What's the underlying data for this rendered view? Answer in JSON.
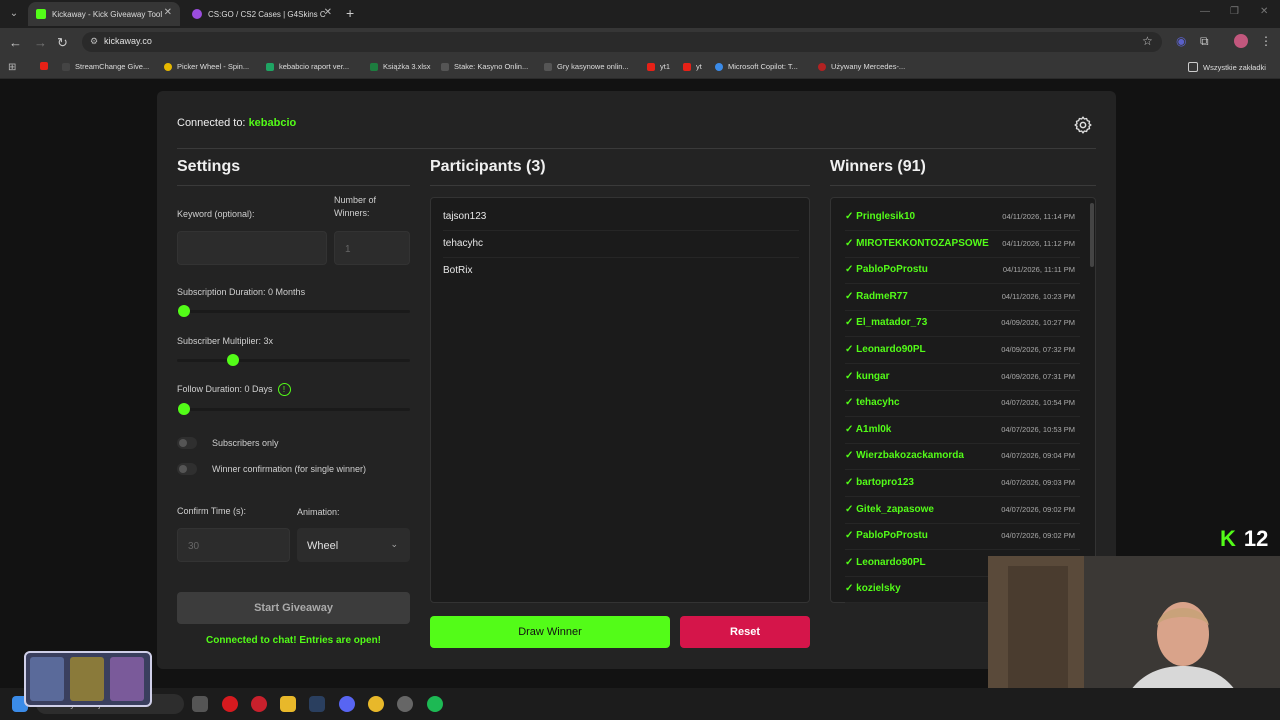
{
  "browser": {
    "tabs": [
      {
        "title": "Kickaway - Kick Giveaway Tool",
        "active": true
      },
      {
        "title": "CS:GO / CS2 Cases | G4Skins C",
        "active": false
      }
    ],
    "url": "kickaway.co",
    "bookmarks": [
      "StreamChange Give...",
      "Picker Wheel - Spin...",
      "kebabcio raport ver...",
      "Książka 3.xlsx",
      "Stake: Kasyno Onlin...",
      "Gry kasynowe onlin...",
      "yt1",
      "yt",
      "Microsoft Copilot: T...",
      "Używany Mercedes-..."
    ],
    "all_bookmarks": "Wszystkie zakładki"
  },
  "connection": {
    "prefix": "Connected to:",
    "channel": "kebabcio"
  },
  "settings": {
    "title": "Settings",
    "keyword_label": "Keyword (optional):",
    "winners_label": "Number of Winners:",
    "keyword_value": "",
    "winners_placeholder": "1",
    "sub_duration_label": "Subscription Duration: 0 Months",
    "sub_duration_value": 0,
    "multiplier_label": "Subscriber Multiplier: 3x",
    "multiplier_fraction": 0.24,
    "follow_label": "Follow Duration:  0  Days",
    "follow_value": 0,
    "subs_only_label": "Subscribers only",
    "winner_confirm_label": "Winner confirmation (for single winner)",
    "confirm_time_label": "Confirm Time (s):",
    "confirm_time_placeholder": "30",
    "animation_label": "Animation:",
    "animation_value": "Wheel",
    "start_label": "Start Giveaway",
    "status_text": "Connected to chat! Entries are open!"
  },
  "participants": {
    "title": "Participants (3)",
    "items": [
      "tajson123",
      "tehacyhc",
      "BotRix"
    ],
    "draw_label": "Draw Winner",
    "reset_label": "Reset"
  },
  "winners": {
    "title": "Winners (91)",
    "items": [
      {
        "name": "✓ Pringlesik10",
        "date": "04/11/2026, 11:14 PM"
      },
      {
        "name": "✓ MIROTEKKONTOZAPSOWE",
        "date": "04/11/2026, 11:12 PM"
      },
      {
        "name": "✓ PabloPoProstu",
        "date": "04/11/2026, 11:11 PM"
      },
      {
        "name": "✓ RadmeR77",
        "date": "04/11/2026, 10:23 PM"
      },
      {
        "name": "✓ El_matador_73",
        "date": "04/09/2026, 10:27 PM"
      },
      {
        "name": "✓ Leonardo90PL",
        "date": "04/09/2026, 07:32 PM"
      },
      {
        "name": "✓ kungar",
        "date": "04/09/2026, 07:31 PM"
      },
      {
        "name": "✓ tehacyhc",
        "date": "04/07/2026, 10:54 PM"
      },
      {
        "name": "✓ A1ml0k",
        "date": "04/07/2026, 10:53 PM"
      },
      {
        "name": "✓ Wierzbakozackamorda",
        "date": "04/07/2026, 09:04 PM"
      },
      {
        "name": "✓ bartopro123",
        "date": "04/07/2026, 09:03 PM"
      },
      {
        "name": "✓ Gitek_zapasowe",
        "date": "04/07/2026, 09:02 PM"
      },
      {
        "name": "✓ PabloPoProstu",
        "date": "04/07/2026, 09:02 PM"
      },
      {
        "name": "✓ Leonardo90PL",
        "date": ""
      },
      {
        "name": "✓ kozielsky",
        "date": ""
      }
    ]
  },
  "overlay": {
    "kick_count": "12"
  },
  "taskbar": {
    "search_placeholder": "Wyszukaj"
  },
  "colors": {
    "accent": "#53fc18",
    "reset": "#d5154a",
    "panel": "#232323"
  }
}
